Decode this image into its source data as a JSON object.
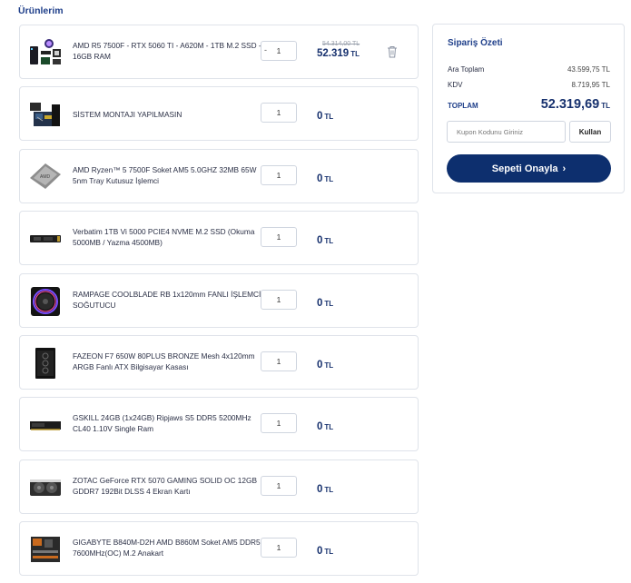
{
  "products_title": "Ürünlerim",
  "items": [
    {
      "name": "AMD R5 7500F - RTX 5060 TI - A620M - 1TB M.2 SSD - 16GB RAM",
      "qty": "1",
      "qty_minus": "-",
      "old_price": "54.314,00 TL",
      "price": "52.319",
      "currency": "TL",
      "image": "pc-bundle-icon"
    },
    {
      "name": "SİSTEM MONTAJI YAPILMASIN",
      "qty": "1",
      "price": "0",
      "currency": "TL",
      "image": "assembly-icon"
    },
    {
      "name": "AMD Ryzen™ 5 7500F Soket AM5 5.0GHZ 32MB 65W 5nm Tray Kutusuz İşlemci",
      "qty": "1",
      "price": "0",
      "currency": "TL",
      "image": "cpu-icon"
    },
    {
      "name": "Verbatim 1TB Vi 5000 PCIE4 NVME M.2 SSD (Okuma 5000MB / Yazma 4500MB)",
      "qty": "1",
      "price": "0",
      "currency": "TL",
      "image": "ssd-icon"
    },
    {
      "name": "RAMPAGE COOLBLADE RB 1x120mm FANLI İŞLEMCİ SOĞUTUCU",
      "qty": "1",
      "price": "0",
      "currency": "TL",
      "image": "cooler-icon"
    },
    {
      "name": "FAZEON F7 650W 80PLUS BRONZE Mesh 4x120mm ARGB Fanlı ATX Bilgisayar Kasası",
      "qty": "1",
      "price": "0",
      "currency": "TL",
      "image": "case-icon"
    },
    {
      "name": "GSKILL 24GB (1x24GB) Ripjaws S5 DDR5 5200MHz CL40 1.10V Single Ram",
      "qty": "1",
      "price": "0",
      "currency": "TL",
      "image": "ram-icon"
    },
    {
      "name": "ZOTAC GeForce RTX 5070 GAMING SOLID OC 12GB GDDR7 192Bit DLSS 4 Ekran Kartı",
      "qty": "1",
      "price": "0",
      "currency": "TL",
      "image": "gpu-icon"
    },
    {
      "name": "GIGABYTE B840M-D2H AMD B860M Soket AM5 DDR5 7600MHz(OC) M.2 Anakart",
      "qty": "1",
      "price": "0",
      "currency": "TL",
      "image": "motherboard-icon"
    }
  ],
  "summary": {
    "title": "Sipariş Özeti",
    "subtotal_label": "Ara Toplam",
    "subtotal_value": "43.599,75 TL",
    "tax_label": "KDV",
    "tax_value": "8.719,95 TL",
    "total_label": "TOPLAM",
    "total_value": "52.319,69",
    "total_currency": "TL",
    "coupon_placeholder": "Kupon Kodunu Giriniz",
    "coupon_button": "Kullan",
    "confirm_button": "Sepeti Onayla",
    "confirm_arrow": "›"
  },
  "colors": {
    "accent": "#0d2f6e",
    "title": "#1f3f8a",
    "border": "#dfe3ea"
  }
}
